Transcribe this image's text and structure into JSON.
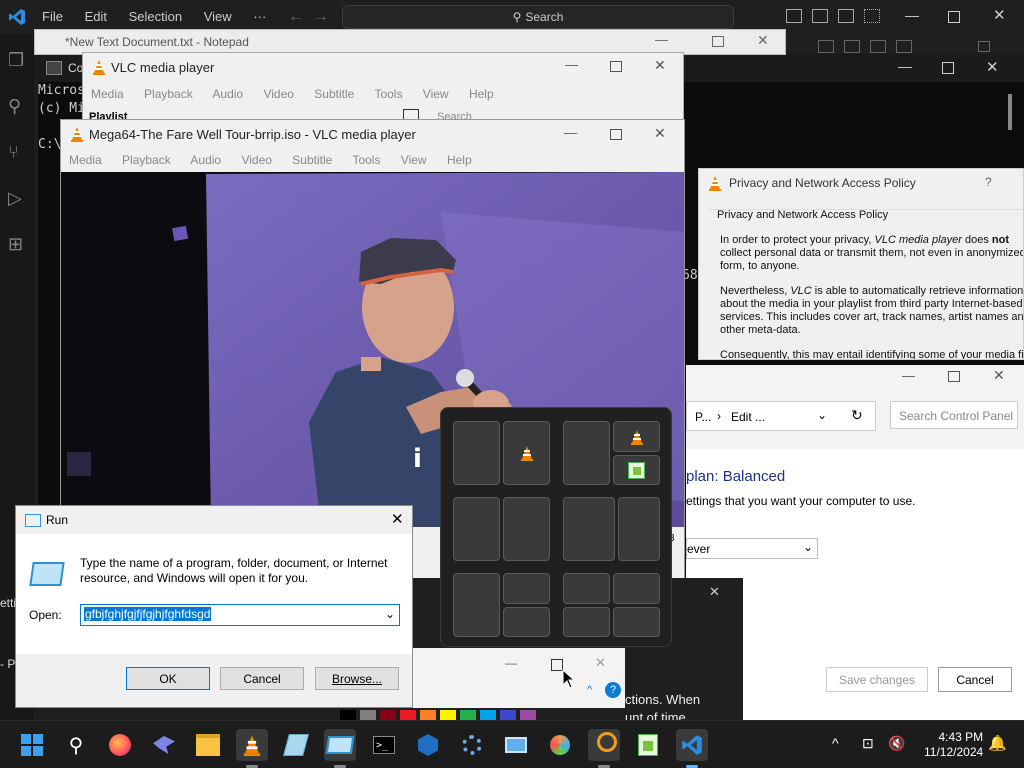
{
  "vscode": {
    "menu": [
      "File",
      "Edit",
      "Selection",
      "View",
      "···"
    ],
    "search": "Search"
  },
  "terminal": {
    "title": "Co",
    "lines": [
      "Micros",
      "(c) Mi",
      "",
      "C:\\"
    ],
    "fragment": "68"
  },
  "notepad": {
    "title": "*New Text Document.txt - Notepad"
  },
  "vlc_back": {
    "title": "VLC media player",
    "menu": [
      "Media",
      "Playback",
      "Audio",
      "Video",
      "Subtitle",
      "Tools",
      "View",
      "Help"
    ],
    "playlist_label": "Playlist",
    "search_placeholder": "Search"
  },
  "vlc_main": {
    "title": "Mega64-The Fare Well Tour-brrip.iso - VLC media player",
    "menu": [
      "Media",
      "Playback",
      "Audio",
      "Video",
      "Subtitle",
      "Tools",
      "View",
      "Help"
    ]
  },
  "privacy": {
    "title": "Privacy and Network Access Policy",
    "help": "?",
    "group": "Privacy and Network Access Policy",
    "p1a": "In order to protect your privacy, ",
    "p1b": "VLC media player",
    "p1c": " does ",
    "p1d": "not",
    "p1e": " collect personal data or transmit them, not even in anonymized form, to anyone.",
    "p2a": "VLC",
    "p2pre": "Nevertheless, ",
    "p2b": " is able to automatically retrieve information about the media in your playlist from third party Internet-based services. This includes cover art, track names, artist names and other meta-data.",
    "p3": "Consequently, this may entail identifying some of your media fil"
  },
  "control_panel": {
    "breadcrumb": [
      "P...",
      "Edit ..."
    ],
    "search_placeholder": "Search Control Panel",
    "heading": "plan: Balanced",
    "subtext": "ettings that you want your computer to use.",
    "select_value": "ever",
    "save_label": "Save changes",
    "cancel_label": "Cancel",
    "fragment1": "ctions. When",
    "fragment2": "unt of time"
  },
  "run": {
    "title": "Run",
    "description": "Type the name of a program, folder, document, or Internet resource, and Windows will open it for you.",
    "open_label": "Open:",
    "open_value": "gfbjfghjfgjfjfgjhjfghfdsgd",
    "ok": "OK",
    "cancel": "Cancel",
    "browse": "Browse..."
  },
  "left_fragments": {
    "a": "etti",
    "b": "- Pa"
  },
  "vlc_fragment": "3",
  "tray": {
    "time": "4:43 PM",
    "date": "11/12/2024",
    "caret": "^"
  },
  "colors": {
    "accent": "#0067c0",
    "vlc_orange": "#f08400",
    "taskbar": "#1c1c1c",
    "selection": "#0078d7"
  },
  "taskbar_icons": [
    "windows-icon",
    "search-icon",
    "firefox-icon",
    "bird-app-icon",
    "file-explorer-icon",
    "vlc-icon",
    "notepad-icon",
    "run-icon",
    "terminal-icon",
    "network-app-icon",
    "settings-icon",
    "remote-desktop-icon",
    "paint-icon",
    "magnifier-icon",
    "notepad-plus-icon",
    "vscode-icon"
  ]
}
